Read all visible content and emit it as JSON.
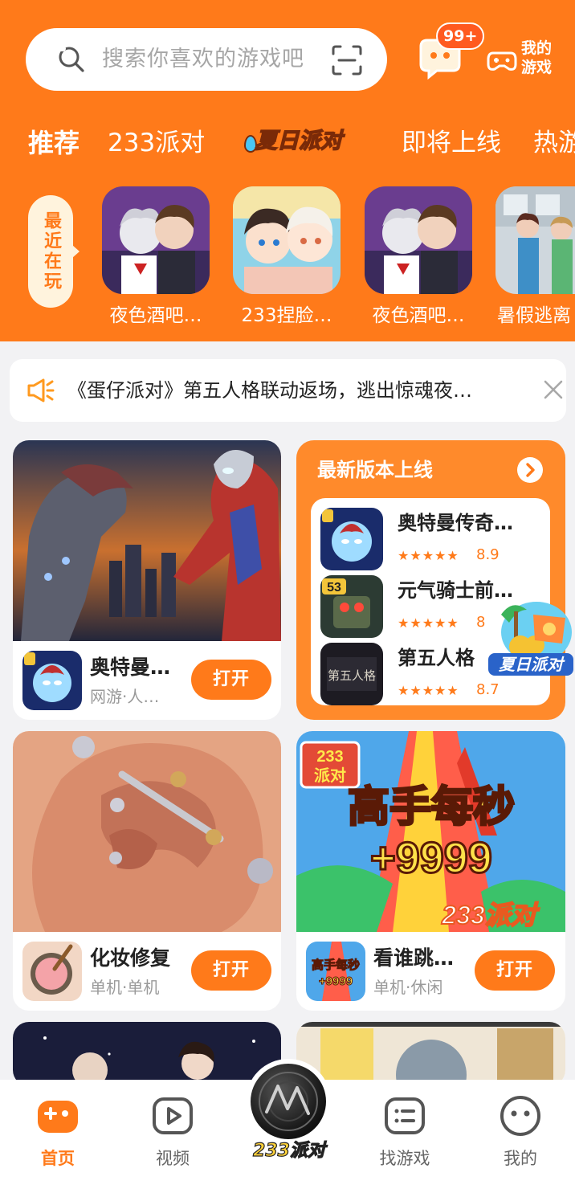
{
  "colors": {
    "brand": "#ff7a1a",
    "background": "#f2f2f4",
    "star": "#ff7a1a"
  },
  "search": {
    "placeholder": "搜索你喜欢的游戏吧"
  },
  "header": {
    "message_badge": "99+",
    "my_games": "我的游戏"
  },
  "tabs": [
    {
      "label": "推荐",
      "active": true
    },
    {
      "label": "233派对"
    },
    {
      "label": "夏日派对",
      "special": true
    },
    {
      "label": "即将上线"
    },
    {
      "label": "热游"
    }
  ],
  "recent": {
    "label": "最近在玩",
    "games": [
      {
        "name": "夜色酒吧…"
      },
      {
        "name": "233捏脸…"
      },
      {
        "name": "夜色酒吧…"
      },
      {
        "name": "暑假逃离"
      }
    ]
  },
  "notice": {
    "text": "《蛋仔派对》第五人格联动返场，逃出惊魂夜…"
  },
  "cards": [
    {
      "name": "奥特曼…",
      "tags": "网游·人…",
      "button": "打开"
    },
    {
      "name": "化妆修复",
      "tags": "单机·单机",
      "button": "打开"
    },
    {
      "name": "看谁跳…",
      "tags": "单机·休闲",
      "button": "打开",
      "cover_text": "高手每秒",
      "cover_number": "+9999",
      "cover_brand": "233派对",
      "icon_text": "高手每秒"
    }
  ],
  "new_versions": {
    "title": "最新版本上线",
    "items": [
      {
        "name": "奥特曼传奇…",
        "rating": 8.9,
        "score": "8.9",
        "stars": "★★★★★"
      },
      {
        "name": "元气骑士前…",
        "rating": 8,
        "score": "8",
        "stars": "★★★★★",
        "icon_text": "53"
      },
      {
        "name": "第五人格",
        "rating": 8.7,
        "score": "8.7",
        "stars": "★★★★★",
        "icon_text": "第五人格"
      }
    ]
  },
  "summer_badge": {
    "label": "夏日派对"
  },
  "bottom_nav": [
    {
      "label": "首页",
      "active": true,
      "icon": "gamepad-icon"
    },
    {
      "label": "视频",
      "icon": "play-icon"
    },
    {
      "label": "233派对",
      "icon": "party-disc-icon"
    },
    {
      "label": "找游戏",
      "icon": "list-icon"
    },
    {
      "label": "我的",
      "icon": "face-icon"
    }
  ]
}
